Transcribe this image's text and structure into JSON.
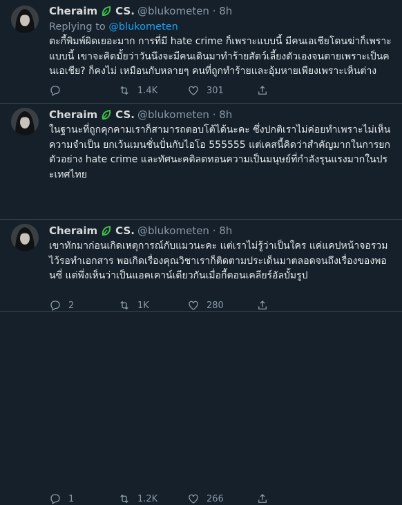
{
  "tweets": [
    {
      "name": "Cheraim",
      "cs": "CS.",
      "handle": "@blukometen",
      "time": "8h",
      "replying_prefix": "Replying to",
      "replying_handle": "@blukometen",
      "text": "ตะกี้พิมพ์ผิดเยอะมาก การที่มี hate crime ก็เพราะแบบนี้ มีคนเอเชียโดนฆ่าก็เพราะแบบนี้ เขาจะคิดมั้ยว่าวันนึงจะมีคนเดินมาทำร้ายสัตว์เลี้ยงตัวเองจนตายเพราะเป็นคนเอเชีย? ก็คงไม่ เหมือนกับหลายๆ คนที่ถูกทำร้ายและอุ้มหายเพียงเพราะเห็นต่าง",
      "replies": "",
      "retweets": "1.4K",
      "likes": "301"
    },
    {
      "name": "Cheraim",
      "cs": "CS.",
      "handle": "@blukometen",
      "time": "8h",
      "text": "ในฐานะที่ถูกคุกคามเราก็สามารถตอบโต้ได้นะคะ ซึ่งปกติเราไม่ค่อยทำเพราะไม่เห็นความจำเป็น ยกเว้นเมนชั่นปั่นกับไอโอ 555555 แต่เคสนี้คิดว่าสำคัญมากในการยกตัวอย่าง hate crime และทัศนะคติลดทอนความเป็นมนุษย์ที่กำลังรุนแรงมากในประเทศไทย",
      "replies": "2",
      "retweets": "1K",
      "likes": "280"
    },
    {
      "name": "Cheraim",
      "cs": "CS.",
      "handle": "@blukometen",
      "time": "8h",
      "text": "เขาทักมาก่อนเกิดเหตุการณ์กับแมวนะคะ แต่เราไม่รู้ว่าเป็นใคร แค่แคปหน้าจอรวมไว้รอทำเอกสาร พอเกิดเรื่องคุณวิชาเราก็ติดตามประเด็นมาตลอดจนถึงเรื่องของพอนซี่ แต่พึ่งเห็นว่าเป็นแอคเคาน์เดียวกันเมื่อกี้ตอนเคลียร์อัลบั้มรูป",
      "replies": "1",
      "retweets": "1.2K",
      "likes": "266"
    }
  ],
  "colors": {
    "background": "#15202b",
    "divider": "#38444d",
    "secondary_text": "#8899a6",
    "link": "#1da1f2",
    "leaf_green": "#3fbf4a"
  }
}
